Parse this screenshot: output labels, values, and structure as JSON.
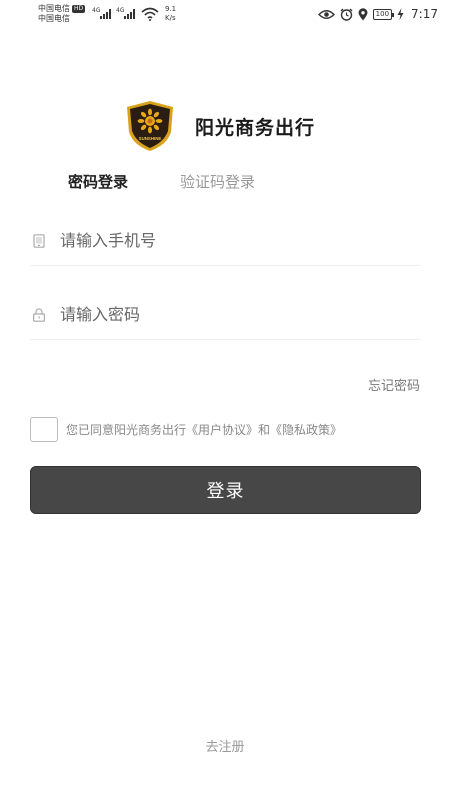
{
  "status_bar": {
    "carrier_1": "中国电信",
    "carrier_hd": "HD",
    "carrier_2": "中国电信",
    "signal_1_type": "4G",
    "signal_2_type": "4G",
    "net_speed_value": "9.1",
    "net_speed_unit": "K/s",
    "battery": "100",
    "time": "7:17",
    "icons": [
      "eye-icon",
      "alarm-icon",
      "location-icon",
      "battery-icon",
      "charging-icon",
      "wifi-icon",
      "signal-icon"
    ]
  },
  "app": {
    "name": "阳光商务出行",
    "logo_text": "SUNSHINE"
  },
  "tabs": [
    {
      "label": "密码登录",
      "active": true
    },
    {
      "label": "验证码登录",
      "active": false
    }
  ],
  "form": {
    "phone_placeholder": "请输入手机号",
    "password_placeholder": "请输入密码",
    "forgot_label": "忘记密码",
    "agreement_text": "您已同意阳光商务出行《用户协议》和《隐私政策》",
    "login_label": "登录",
    "register_label": "去注册"
  },
  "colors": {
    "button_bg": "#474747",
    "logo_gold": "#d9a21b",
    "logo_dark": "#2b1d12"
  }
}
